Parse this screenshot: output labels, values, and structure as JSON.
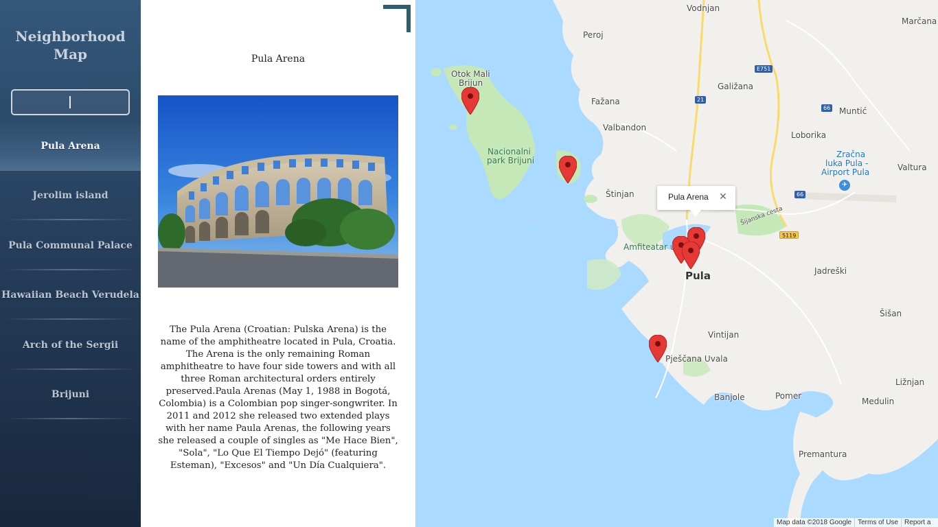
{
  "sidebar": {
    "title": "Neighborhood Map",
    "filter_value": "",
    "items": [
      {
        "label": "Pula Arena",
        "active": true
      },
      {
        "label": "Jerolim island",
        "active": false
      },
      {
        "label": "Pula Communal Palace",
        "active": false
      },
      {
        "label": "Hawaiian Beach Verudela",
        "active": false
      },
      {
        "label": "Arch of the Sergii",
        "active": false
      },
      {
        "label": "Brijuni",
        "active": false
      }
    ]
  },
  "panel": {
    "title": "Pula Arena",
    "image_subject": "Pula Arena amphitheatre",
    "description": "The Pula Arena (Croatian: Pulska Arena) is the name of the amphitheatre located in Pula, Croatia. The Arena is the only remaining Roman amphitheatre to have four side towers and with all three Roman architectural orders entirely preserved.Paula Arenas (May 1, 1988 in Bogotá, Colombia) is a Colombian pop singer-songwriter. In 2011 and 2012 she released two extended plays with her name Paula Arenas, the following years she released a couple of singles as \"Me Hace Bien\", \"Sola\", \"Lo Que El Tiempo Dejó\" (featuring Esteman), \"Excesos\" and \"Un Día Cualquiera\"."
  },
  "map": {
    "labels": {
      "vodnjan": "Vodnjan",
      "marcana": "Marčana",
      "peroj": "Peroj",
      "otok_mali_1": "Otok Mali",
      "otok_mali_2": "Brijun",
      "galizana": "Galižana",
      "fazana": "Fažana",
      "muntic": "Muntić",
      "valbandon": "Valbandon",
      "loborika": "Loborika",
      "nacionalni_1": "Nacionalni",
      "nacionalni_2": "park Brijuni",
      "zracna_1": "Zračna",
      "zracna_2": "luka Pula -",
      "zracna_3": "Airport Pula",
      "valtura": "Valtura",
      "stinjan": "Štinjan",
      "siljanska": "Šijanska cesta",
      "amfiteatar": "Amfiteatar u",
      "pula": "Pula",
      "jadreski": "Jadreški",
      "sisan": "Šišan",
      "vintijan": "Vintijan",
      "pjescana": "Pješčana Uvala",
      "liznjan": "Ližnjan",
      "banjole": "Banjole",
      "pomer": "Pomer",
      "medulin": "Medulin",
      "premantura": "Premantura"
    },
    "shields": {
      "e751": "E751",
      "r21": "21",
      "r66a": "66",
      "r66b": "66",
      "r5119": "5119"
    },
    "infowindow": {
      "title": "Pula Arena",
      "close": "✕"
    },
    "attribution": {
      "data": "Map data ©2018 Google",
      "terms": "Terms of Use",
      "report": "Report a"
    }
  },
  "colors": {
    "sidebar_top": "#34587a",
    "sidebar_bottom": "#18273d",
    "water": "#aadaff",
    "land": "#f1f0ec",
    "park": "#c5e8b8",
    "marker": "#e53935",
    "corner_mark": "#2f5f6b"
  }
}
